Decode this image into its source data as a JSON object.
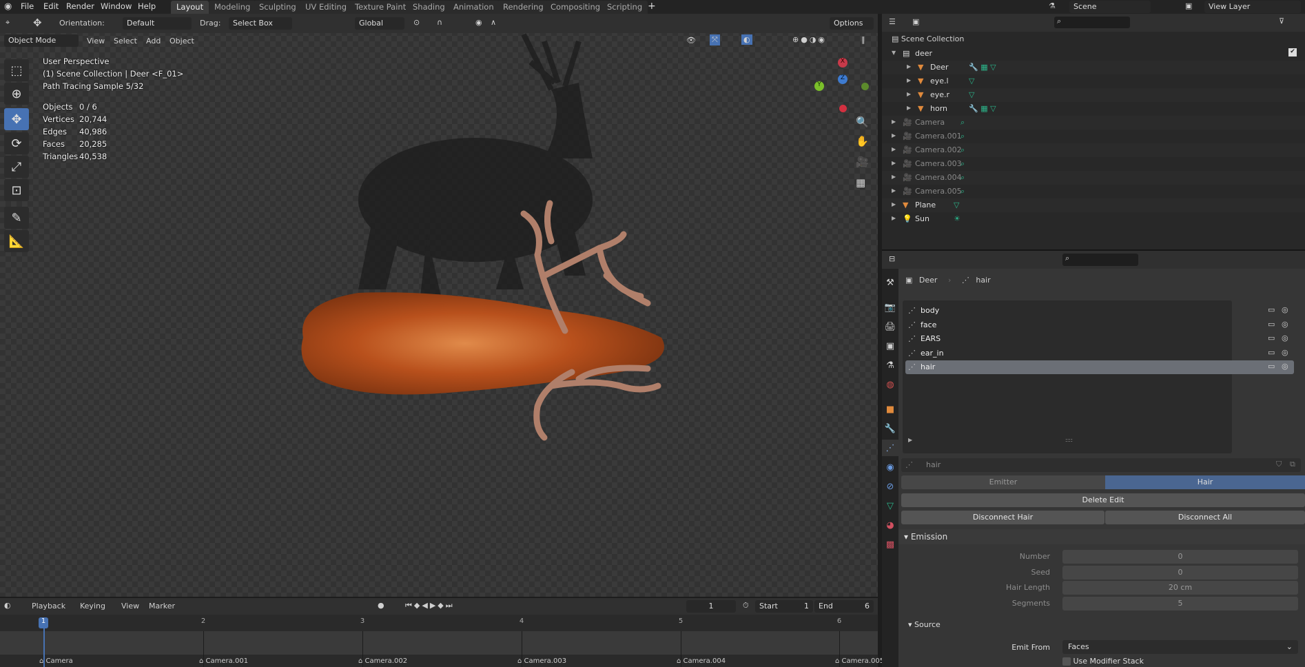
{
  "topbar": {
    "menus": [
      "File",
      "Edit",
      "Render",
      "Window",
      "Help"
    ],
    "workspaces": [
      "Layout",
      "Modeling",
      "Sculpting",
      "UV Editing",
      "Texture Paint",
      "Shading",
      "Animation",
      "Rendering",
      "Compositing",
      "Scripting"
    ],
    "active_workspace": "Layout",
    "add_tab": "+",
    "scene": "Scene",
    "view_layer": "View Layer"
  },
  "toolsettings": {
    "orientation_label": "Orientation:",
    "orientation": "Default",
    "drag_label": "Drag:",
    "drag": "Select Box",
    "transform_orientation": "Global",
    "options": "Options"
  },
  "viewport_header": {
    "mode": "Object Mode",
    "menus": [
      "View",
      "Select",
      "Add",
      "Object"
    ]
  },
  "overlay": {
    "perspective": "User Perspective",
    "collection": "(1) Scene Collection | Deer <F_01>",
    "render": "Path Tracing Sample 5/32",
    "stats": [
      {
        "label": "Objects",
        "value": "0 / 6"
      },
      {
        "label": "Vertices",
        "value": "20,744"
      },
      {
        "label": "Edges",
        "value": "40,986"
      },
      {
        "label": "Faces",
        "value": "20,285"
      },
      {
        "label": "Triangles",
        "value": "40,538"
      }
    ]
  },
  "gizmo": {
    "x": "X",
    "y": "Y",
    "z": "Z"
  },
  "outliner": {
    "root": "Scene Collection",
    "items": [
      {
        "name": "deer",
        "type": "collection",
        "level": 1
      },
      {
        "name": "Deer",
        "type": "mesh",
        "level": 2
      },
      {
        "name": "eye.l",
        "type": "mesh",
        "level": 2
      },
      {
        "name": "eye.r",
        "type": "mesh",
        "level": 2
      },
      {
        "name": "horn",
        "type": "mesh",
        "level": 2
      },
      {
        "name": "Camera",
        "type": "camera",
        "level": 1
      },
      {
        "name": "Camera.001",
        "type": "camera",
        "level": 1
      },
      {
        "name": "Camera.002",
        "type": "camera",
        "level": 1
      },
      {
        "name": "Camera.003",
        "type": "camera",
        "level": 1
      },
      {
        "name": "Camera.004",
        "type": "camera",
        "level": 1
      },
      {
        "name": "Camera.005",
        "type": "camera",
        "level": 1
      },
      {
        "name": "Plane",
        "type": "mesh",
        "level": 1
      },
      {
        "name": "Sun",
        "type": "light",
        "level": 1
      }
    ]
  },
  "properties": {
    "breadcrumb": [
      "Deer",
      "hair"
    ],
    "particle_systems": [
      "body",
      "face",
      "EARS",
      "ear_in",
      "hair"
    ],
    "selected": "hair",
    "name_field": "hair",
    "type_tabs": [
      "Emitter",
      "Hair"
    ],
    "active_type": "Hair",
    "delete_edit": "Delete Edit",
    "disconnect_hair": "Disconnect Hair",
    "disconnect_all": "Disconnect All",
    "emission": {
      "title": "Emission",
      "fields": [
        {
          "label": "Number",
          "value": "0"
        },
        {
          "label": "Seed",
          "value": "0"
        },
        {
          "label": "Hair Length",
          "value": "20 cm"
        },
        {
          "label": "Segments",
          "value": "5"
        }
      ]
    },
    "source": {
      "title": "Source",
      "emit_from_label": "Emit From",
      "emit_from": "Faces",
      "use_modifier_stack": "Use Modifier Stack"
    }
  },
  "timeline": {
    "menus": [
      "Playback",
      "Keying",
      "View",
      "Marker"
    ],
    "current_frame": "1",
    "start_label": "Start",
    "start": "1",
    "end_label": "End",
    "end": "6",
    "frames": [
      "1",
      "2",
      "3",
      "4",
      "5",
      "6"
    ],
    "markers": [
      "Camera",
      "Camera.001",
      "Camera.002",
      "Camera.003",
      "Camera.004",
      "Camera.005"
    ]
  },
  "colors": {
    "accent": "#4772b3",
    "mesh": "#e08a3c",
    "data_green": "#2bb58a"
  }
}
